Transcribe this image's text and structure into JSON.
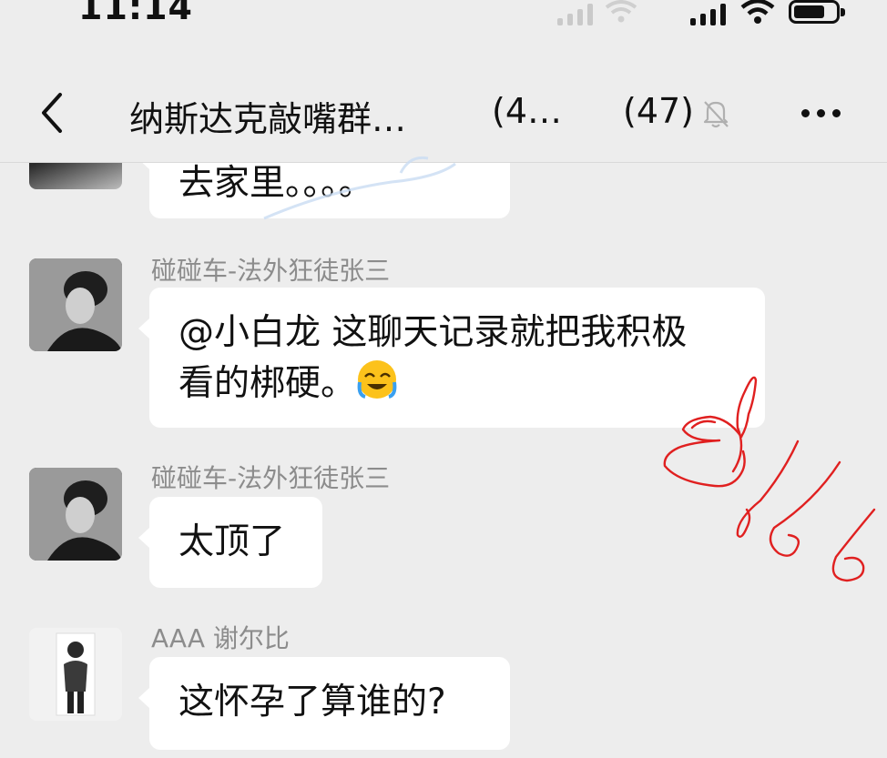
{
  "status_bar": {
    "time": "11:14"
  },
  "nav": {
    "title": "纳斯达克敲嘴群",
    "title_suffix": "…",
    "ghost_title": "(4…",
    "member_count": "(47)"
  },
  "messages": [
    {
      "sender": "",
      "text": "去家里。。。。"
    },
    {
      "sender": "碰碰车-法外狂徒张三",
      "text_line1": "@小白龙 这聊天记录就把我积极",
      "text_line2": "看的梆硬。"
    },
    {
      "sender": "碰碰车-法外狂徒张三",
      "text": "太顶了"
    },
    {
      "sender": "AAA 谢尔比",
      "text": "这怀孕了算谁的?"
    }
  ],
  "icons": {
    "back": "chevron-left-icon",
    "mute": "bell-slash-icon",
    "more": "more-dots-icon",
    "emoji": "face-palm-emoji"
  },
  "colors": {
    "background": "#ededed",
    "bubble": "#ffffff",
    "sender": "#8c8c8c",
    "scribble": "#e02020"
  }
}
